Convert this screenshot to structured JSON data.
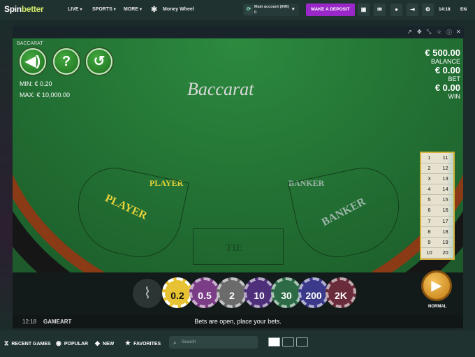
{
  "header": {
    "logo": {
      "spin": "Spin",
      "bet": "better"
    },
    "nav": [
      {
        "label": "LIVE"
      },
      {
        "label": "SPORTS"
      },
      {
        "label": "MORE"
      }
    ],
    "featured": "Money Wheel",
    "account": {
      "title": "Main account (INR)",
      "balance": "0"
    },
    "deposit_label": "MAKE A DEPOSIT",
    "clock": "14:18",
    "language": "EN"
  },
  "game": {
    "label": "BACCARAT",
    "brand": "Baccarat",
    "min": "MIN:  € 0.20",
    "max": "MAX: € 10,000.00",
    "balance_amount": "€ 500.00",
    "balance_label": "BALANCE",
    "bet_amount": "€ 0.00",
    "bet_label": "BET",
    "win_amount": "€ 0.00",
    "win_label": "WIN",
    "player_top": "PLAYER",
    "banker_top": "BANKER",
    "player_zone": "PLAYER",
    "tie_zone": "TIE",
    "banker_zone": "BANKER",
    "scoreboard": [
      "1",
      "11",
      "2",
      "12",
      "3",
      "13",
      "4",
      "14",
      "5",
      "15",
      "6",
      "16",
      "7",
      "17",
      "8",
      "18",
      "9",
      "19",
      "10",
      "20"
    ],
    "chips": [
      "0.2",
      "0.5",
      "2",
      "10",
      "30",
      "200",
      "2K"
    ],
    "play_mode": "NORMAL",
    "time": "12:18",
    "provider": "GAMEART",
    "status": "Bets are open, place your bets."
  },
  "bottom_nav": {
    "recent": "RECENT GAMES",
    "popular": "POPULAR",
    "new": "NEW",
    "favorites": "FAVORITES",
    "search_placeholder": "Search"
  },
  "colors": {
    "felt": "#226f33",
    "deposit": "#9a28c8",
    "chip_selected": "#e7c232"
  }
}
